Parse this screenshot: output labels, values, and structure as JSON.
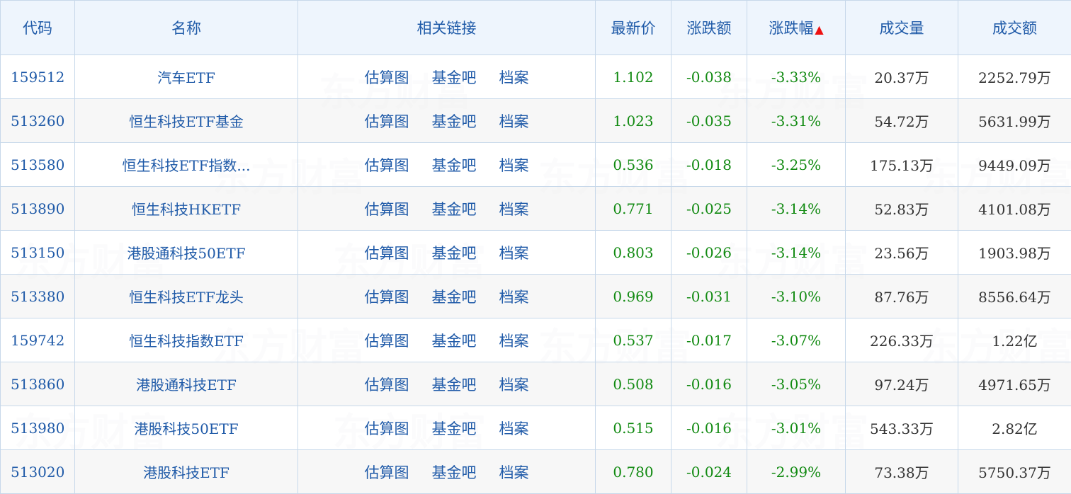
{
  "table": {
    "headers": {
      "code": "代码",
      "name": "名称",
      "links": "相关链接",
      "price": "最新价",
      "change": "涨跌额",
      "change_pct": "涨跌幅",
      "volume": "成交量",
      "turnover": "成交额"
    },
    "sort_indicator": "▲",
    "link_labels": {
      "chart": "估算图",
      "forum": "基金吧",
      "profile": "档案"
    },
    "rows": [
      {
        "code": "159512",
        "name": "汽车ETF",
        "price": "1.102",
        "change": "-0.038",
        "change_pct": "-3.33%",
        "volume": "20.37万",
        "turnover": "2252.79万"
      },
      {
        "code": "513260",
        "name": "恒生科技ETF基金",
        "price": "1.023",
        "change": "-0.035",
        "change_pct": "-3.31%",
        "volume": "54.72万",
        "turnover": "5631.99万"
      },
      {
        "code": "513580",
        "name": "恒生科技ETF指数...",
        "price": "0.536",
        "change": "-0.018",
        "change_pct": "-3.25%",
        "volume": "175.13万",
        "turnover": "9449.09万"
      },
      {
        "code": "513890",
        "name": "恒生科技HKETF",
        "price": "0.771",
        "change": "-0.025",
        "change_pct": "-3.14%",
        "volume": "52.83万",
        "turnover": "4101.08万"
      },
      {
        "code": "513150",
        "name": "港股通科技50ETF",
        "price": "0.803",
        "change": "-0.026",
        "change_pct": "-3.14%",
        "volume": "23.56万",
        "turnover": "1903.98万"
      },
      {
        "code": "513380",
        "name": "恒生科技ETF龙头",
        "price": "0.969",
        "change": "-0.031",
        "change_pct": "-3.10%",
        "volume": "87.76万",
        "turnover": "8556.64万"
      },
      {
        "code": "159742",
        "name": "恒生科技指数ETF",
        "price": "0.537",
        "change": "-0.017",
        "change_pct": "-3.07%",
        "volume": "226.33万",
        "turnover": "1.22亿"
      },
      {
        "code": "513860",
        "name": "港股通科技ETF",
        "price": "0.508",
        "change": "-0.016",
        "change_pct": "-3.05%",
        "volume": "97.24万",
        "turnover": "4971.65万"
      },
      {
        "code": "513980",
        "name": "港股科技50ETF",
        "price": "0.515",
        "change": "-0.016",
        "change_pct": "-3.01%",
        "volume": "543.33万",
        "turnover": "2.82亿"
      },
      {
        "code": "513020",
        "name": "港股科技ETF",
        "price": "0.780",
        "change": "-0.024",
        "change_pct": "-2.99%",
        "volume": "73.38万",
        "turnover": "5750.37万"
      }
    ]
  },
  "watermark": {
    "text": "东方财富"
  },
  "colors": {
    "link": "#1f5aa8",
    "negative": "#118a11",
    "header_bg": "#eef5fd",
    "sort_arrow": "#ee1111"
  }
}
